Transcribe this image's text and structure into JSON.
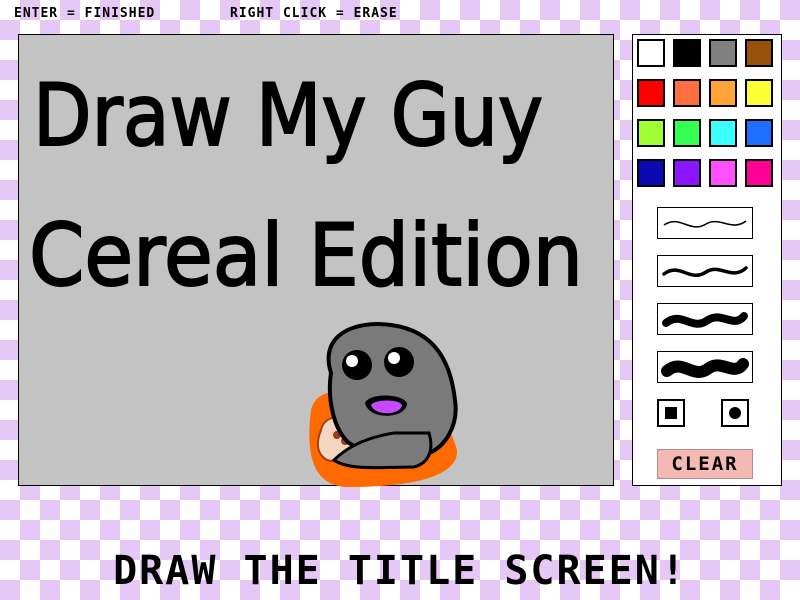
{
  "hints": {
    "finish": "ENTER = FINISHED",
    "erase": "RIGHT CLICK = ERASE"
  },
  "canvas": {
    "drawing_line1": "Draw My Guy",
    "drawing_line2": "Cereal Edition",
    "background": "#c3c3c3"
  },
  "palette": {
    "colors": [
      "#ffffff",
      "#000000",
      "#808080",
      "#96500a",
      "#ff0000",
      "#ff6e41",
      "#ffa537",
      "#ffff37",
      "#a0ff32",
      "#32ff50",
      "#3cffff",
      "#1e6eff",
      "#0a0ab4",
      "#8c14ff",
      "#ff50ff",
      "#ff0096"
    ]
  },
  "brushes": [
    "thin",
    "medium",
    "thick",
    "extra-thick"
  ],
  "brush_shapes": [
    "square",
    "round"
  ],
  "clear_label": "CLEAR",
  "footer": "DRAW THE TITLE SCREEN!"
}
